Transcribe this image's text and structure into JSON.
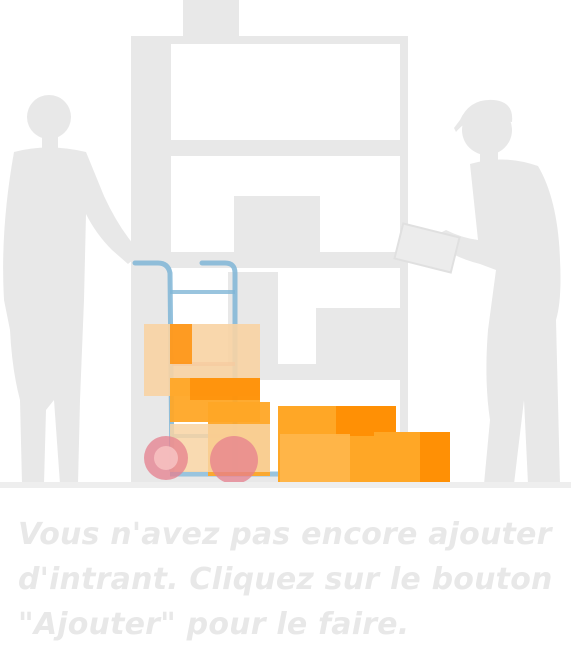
{
  "empty_state": {
    "message": "Vous n'avez pas encore ajouter\nd'intrant. Cliquez sur le bouton\n\"Ajouter\" pour le faire."
  },
  "colors": {
    "silhouette": "#e8e8e8",
    "box_orange": "#ffa726",
    "box_dark_orange": "#ff8c00",
    "box_light": "#f8d3a3",
    "trolley_blue": "#7fb5d6",
    "wheel_pink": "#e57f8e"
  },
  "illustration": {
    "icons": [
      "warehouse-shelf-icon",
      "person-silhouette-icon",
      "hand-trolley-icon",
      "cardboard-box-icon"
    ]
  }
}
